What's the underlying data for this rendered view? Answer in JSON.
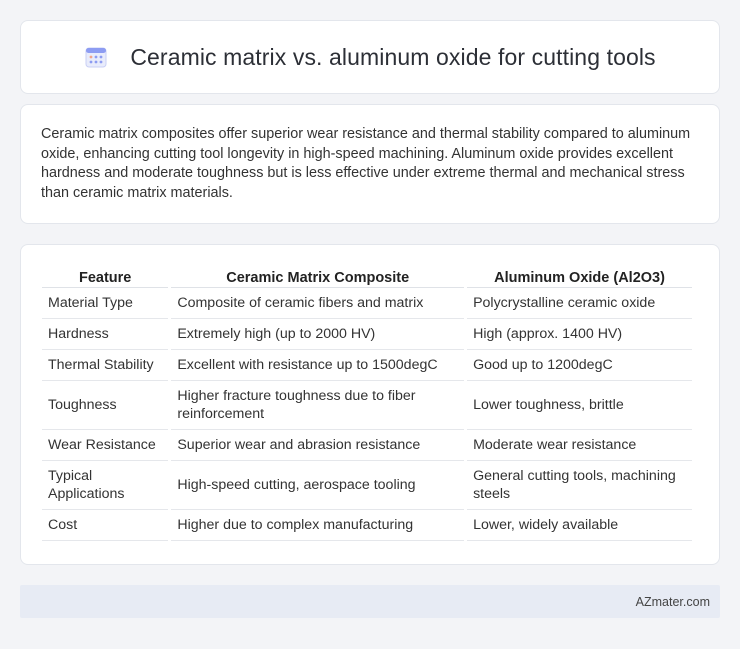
{
  "header": {
    "icon": "calendar-grid-icon",
    "title": "Ceramic matrix vs. aluminum oxide for cutting tools"
  },
  "summary": {
    "text": "Ceramic matrix composites offer superior wear resistance and thermal stability compared to aluminum oxide, enhancing cutting tool longevity in high-speed machining. Aluminum oxide provides excellent hardness and moderate toughness but is less effective under extreme thermal and mechanical stress than ceramic matrix materials."
  },
  "table": {
    "headers": [
      "Feature",
      "Ceramic Matrix Composite",
      "Aluminum Oxide (Al2O3)"
    ],
    "rows": [
      [
        "Material Type",
        "Composite of ceramic fibers and matrix",
        "Polycrystalline ceramic oxide"
      ],
      [
        "Hardness",
        "Extremely high (up to 2000 HV)",
        "High (approx. 1400 HV)"
      ],
      [
        "Thermal Stability",
        "Excellent with resistance up to 1500degC",
        "Good up to 1200degC"
      ],
      [
        "Toughness",
        "Higher fracture toughness due to fiber reinforcement",
        "Lower toughness, brittle"
      ],
      [
        "Wear Resistance",
        "Superior wear and abrasion resistance",
        "Moderate wear resistance"
      ],
      [
        "Typical Applications",
        "High-speed cutting, aerospace tooling",
        "General cutting tools, machining steels"
      ],
      [
        "Cost",
        "Higher due to complex manufacturing",
        "Lower, widely available"
      ]
    ]
  },
  "footer": {
    "text": "AZmater.com"
  },
  "colors": {
    "background": "#f3f4f7",
    "card": "#ffffff",
    "footer": "#e7ebf4",
    "icon_accent": "#7b8cf0"
  }
}
